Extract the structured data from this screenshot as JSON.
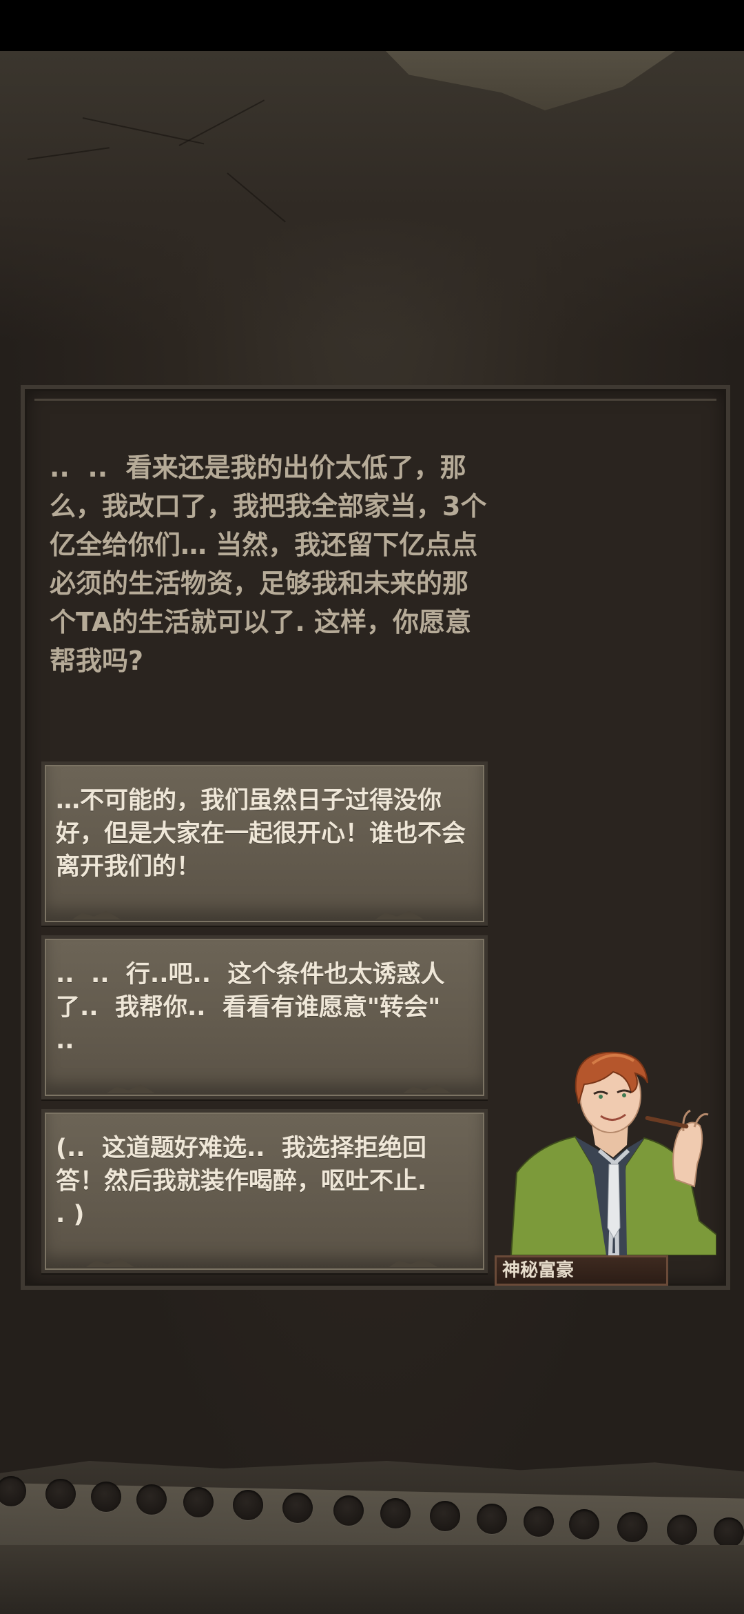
{
  "question": {
    "text": "..  ..  看来还是我的出价太低了，那么，我改口了，我把我全部家当，3个亿全给你们… 当然，我还留下亿点点必须的生活物资，足够我和未来的那个TA的生活就可以了. 这样，你愿意帮我吗?"
  },
  "options": [
    {
      "text": "…不可能的，我们虽然日子过得没你好，但是大家在一起很开心！谁也不会离开我们的！"
    },
    {
      "text": "..  ..  行..吧..  这个条件也太诱惑人了..  我帮你..  看看有谁愿意\"转会\"\n.."
    },
    {
      "text": "(..  这道题好难选..  我选择拒绝回答！然后我就装作喝醉，呕吐不止.\n. )"
    }
  ],
  "character": {
    "name": "神秘富豪",
    "icon": "character-portrait"
  },
  "colors": {
    "background": "#241f1b",
    "panel": "#2a241f",
    "question_text": "#b6ab98",
    "option_card": "#655d50",
    "option_text": "#efe7d8"
  }
}
